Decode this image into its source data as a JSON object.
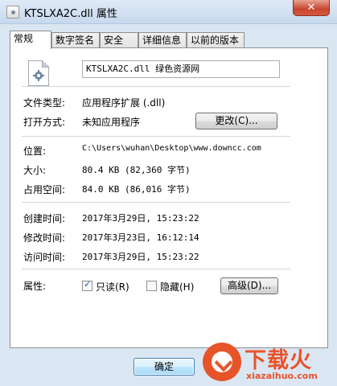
{
  "window": {
    "title": "KTSLXA2C.dll 属性",
    "close_label": "✕"
  },
  "tabs": [
    {
      "label": "常规"
    },
    {
      "label": "数字签名"
    },
    {
      "label": "安全"
    },
    {
      "label": "详细信息"
    },
    {
      "label": "以前的版本"
    }
  ],
  "general": {
    "file_name": "KTSLXA2C.dll 绿色资源网",
    "file_type_label": "文件类型:",
    "file_type_value": "应用程序扩展 (.dll)",
    "opens_with_label": "打开方式:",
    "opens_with_value": "未知应用程序",
    "change_button": "更改(C)...",
    "location_label": "位置:",
    "location_value": "C:\\Users\\wuhan\\Desktop\\www.downcc.com",
    "size_label": "大小:",
    "size_value": "80.4 KB (82,360 字节)",
    "size_on_disk_label": "占用空间:",
    "size_on_disk_value": "84.0 KB (86,016 字节)",
    "created_label": "创建时间:",
    "created_value": "2017年3月29日, 15:23:22",
    "modified_label": "修改时间:",
    "modified_value": "2017年3月23日, 16:12:14",
    "accessed_label": "访问时间:",
    "accessed_value": "2017年3月29日, 15:23:22",
    "attributes_label": "属性:",
    "readonly_label": "只读(R)",
    "readonly_checked": true,
    "hidden_label": "隐藏(H)",
    "hidden_checked": false,
    "advanced_button": "高级(D)..."
  },
  "footer": {
    "ok_button": "确定"
  },
  "watermark": {
    "brand": "下载火",
    "url": "xiazaihuo.com"
  },
  "colors": {
    "accent": "#e8542a",
    "window_frame": "#dbe6f3",
    "close_button": "#c7452f"
  }
}
